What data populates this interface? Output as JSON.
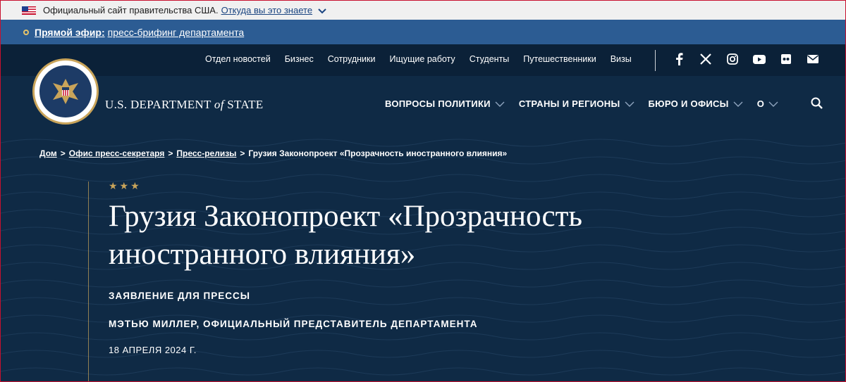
{
  "gov_banner": {
    "text": "Официальный сайт правительства США.",
    "link": "Откуда вы это знаете"
  },
  "live_banner": {
    "strong": "Прямой эфир:",
    "link": "пресс-брифинг департамента"
  },
  "header": {
    "wordmark_before": "U.S. DEPARTMENT ",
    "wordmark_of": "of",
    "wordmark_after": " STATE",
    "utility_nav": [
      "Отдел новостей",
      "Бизнес",
      "Сотрудники",
      "Ищущие работу",
      "Студенты",
      "Путешественники",
      "Визы"
    ],
    "social_icons": [
      "facebook-icon",
      "x-icon",
      "instagram-icon",
      "youtube-icon",
      "flickr-icon",
      "email-icon"
    ],
    "main_nav": [
      "ВОПРОСЫ ПОЛИТИКИ",
      "СТРАНЫ И РЕГИОНЫ",
      "БЮРО И ОФИСЫ",
      "О"
    ]
  },
  "breadcrumb": {
    "items": [
      "Дом",
      "Офис пресс-секретаря",
      "Пресс-релизы",
      "Грузия Законопроект «Прозрачность иностранного влияния»"
    ],
    "separator": ">"
  },
  "article": {
    "stars": "★★★",
    "title": "Грузия Законопроект «Прозрачность иностранного влияния»",
    "kicker": "ЗАЯВЛЕНИЕ ДЛЯ ПРЕССЫ",
    "byline": "МЭТЬЮ МИЛЛЕР, ОФИЦИАЛЬНЫЙ ПРЕДСТАВИТЕЛЬ ДЕПАРТАМЕНТА",
    "date": "18 АПРЕЛЯ 2024 Г."
  },
  "colors": {
    "navy": "#0f2a45",
    "live_blue": "#2c5c93",
    "gold": "#c9a45a"
  }
}
